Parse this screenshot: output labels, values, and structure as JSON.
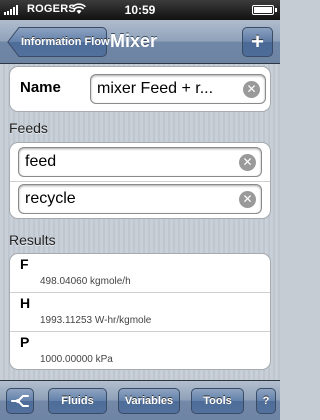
{
  "status_bar": {
    "carrier": "ROGERS",
    "time": "10:59",
    "icons": [
      "signal-bars",
      "wifi",
      "battery"
    ]
  },
  "nav": {
    "back_label": "Information Flow",
    "title": "Mixer",
    "add_symbol": "+"
  },
  "name_section": {
    "label": "Name",
    "value": "mixer Feed + r..."
  },
  "feeds": {
    "label": "Feeds",
    "items": [
      "feed",
      "recycle"
    ]
  },
  "results": {
    "label": "Results",
    "rows": [
      {
        "symbol": "F",
        "value": "498.04060 kgmole/h"
      },
      {
        "symbol": "H",
        "value": "1993.11253 W-hr/kgmole"
      },
      {
        "symbol": "P",
        "value": "1000.00000 kPa"
      }
    ]
  },
  "toolbar": {
    "connect_icon": "connection",
    "fluids": "Fluids",
    "variables": "Variables",
    "tools": "Tools",
    "help": "?"
  }
}
